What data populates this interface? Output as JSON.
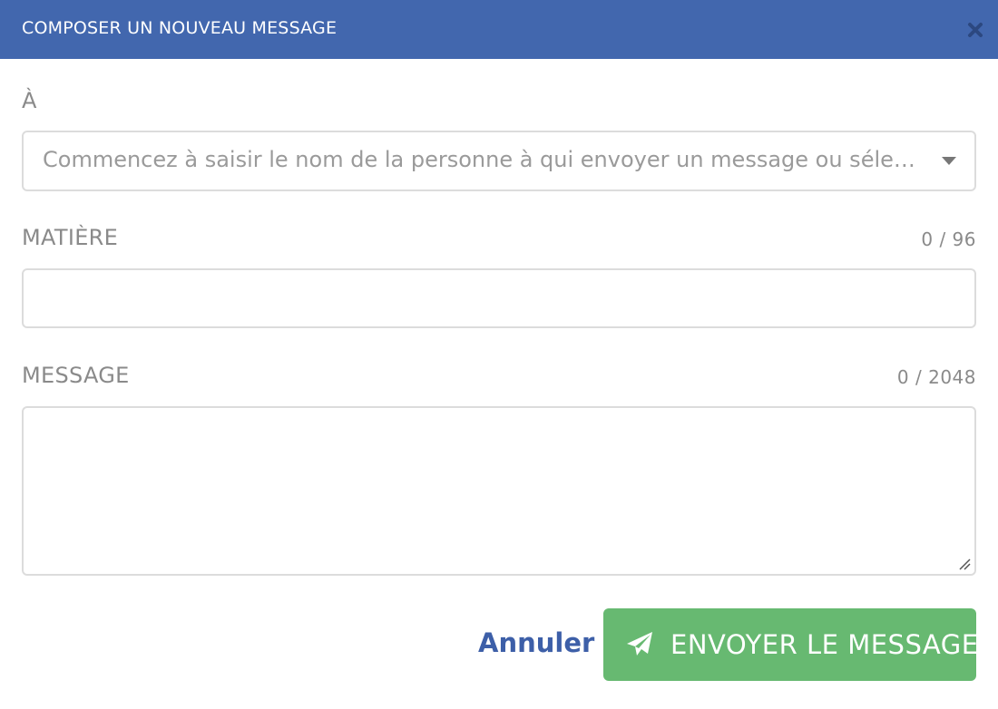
{
  "dialog": {
    "title": "COMPOSER UN NOUVEAU MESSAGE",
    "close_icon": "close-icon"
  },
  "recipient": {
    "label": "À",
    "placeholder": "Commencez à saisir le nom de la personne à qui envoyer un message ou séle…"
  },
  "subject": {
    "label": "MATIÈRE",
    "counter": "0 / 96",
    "value": ""
  },
  "message": {
    "label": "MESSAGE",
    "counter": "0 / 2048",
    "value": ""
  },
  "actions": {
    "cancel_label": "Annuler",
    "send_label": "ENVOYER LE MESSAGE",
    "send_icon": "paper-plane-icon"
  },
  "colors": {
    "header": "#4267ae",
    "send_button": "#67b971",
    "cancel_link": "#3d5fa8"
  }
}
